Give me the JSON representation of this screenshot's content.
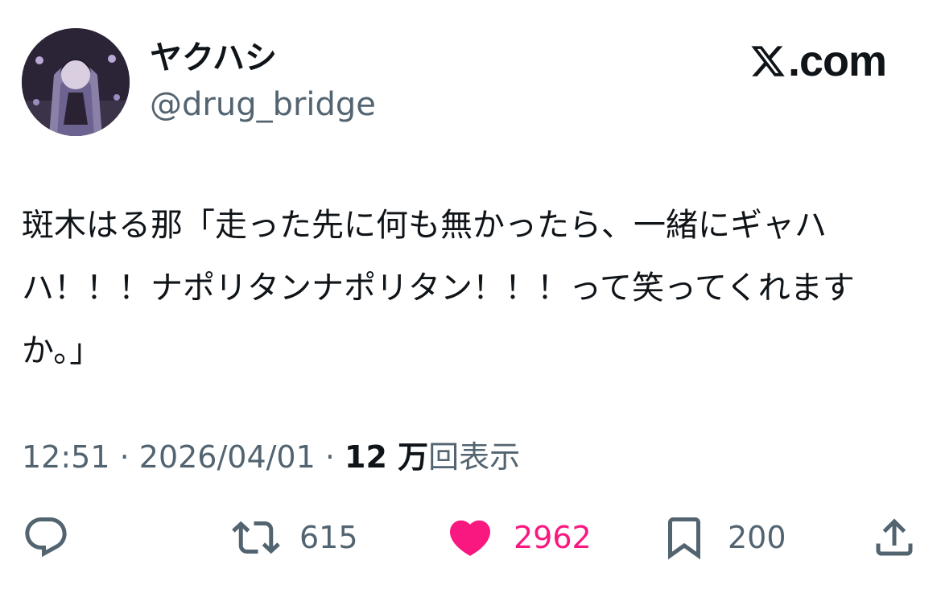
{
  "author": {
    "display_name": "ヤクハシ",
    "handle": "@drug_bridge",
    "avatar_icon": "avatar-illustration"
  },
  "brand": {
    "icon": "x-logo-icon",
    "text": ".com"
  },
  "tweet": {
    "text": "斑木はる那「走った先に何も無かったら、一緒にギャハハ！！！ナポリタンナポリタン！！！って笑ってくれますか。」"
  },
  "meta": {
    "time": "12:51",
    "separator": " · ",
    "date": "2026/04/01",
    "views_count": "12 万",
    "views_label": "回表示"
  },
  "actions": {
    "reply": {
      "icon": "reply-icon",
      "count": ""
    },
    "repost": {
      "icon": "repost-icon",
      "count": "615"
    },
    "like": {
      "icon": "heart-icon",
      "count": "2962",
      "color": "#f91880"
    },
    "bookmark": {
      "icon": "bookmark-icon",
      "count": "200"
    },
    "share": {
      "icon": "share-icon"
    }
  },
  "colors": {
    "text": "#0f1419",
    "secondary": "#536471",
    "like": "#f91880"
  }
}
